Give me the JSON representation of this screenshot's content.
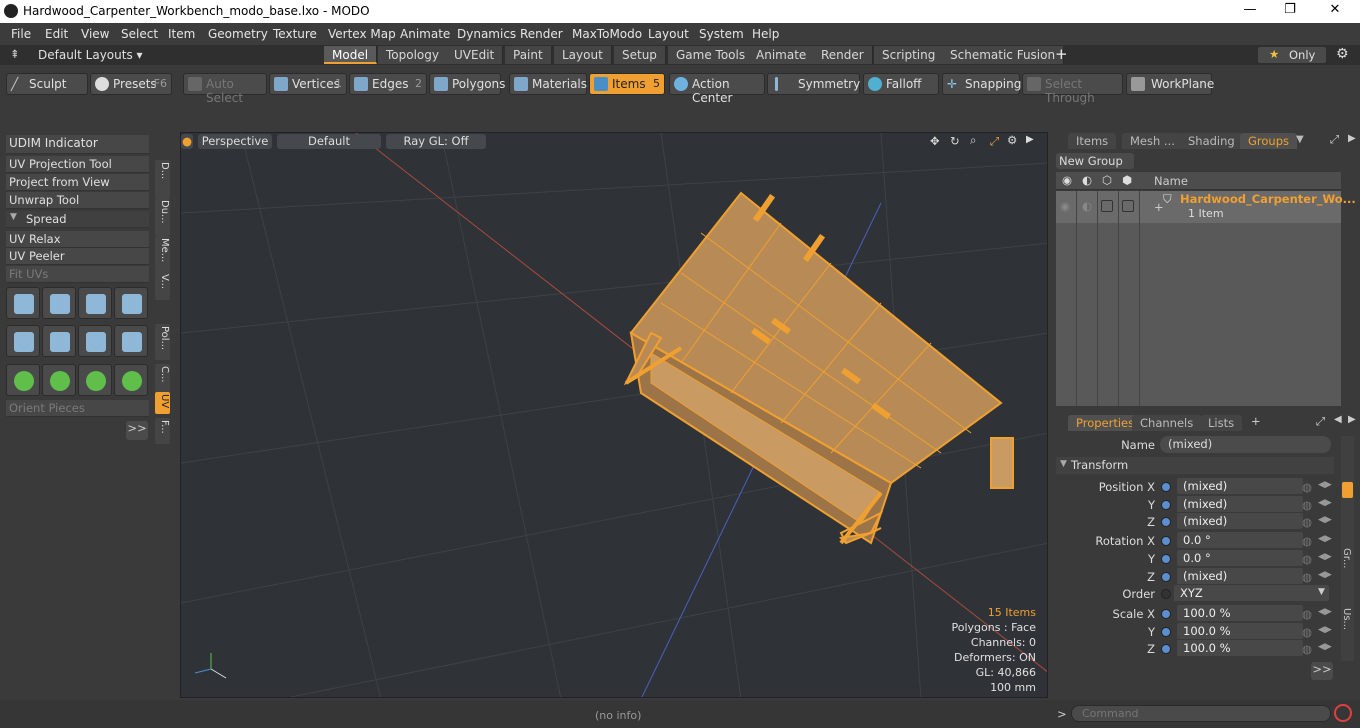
{
  "window": {
    "title": "Hardwood_Carpenter_Workbench_modo_base.lxo - MODO",
    "controls": [
      "—",
      "❐",
      "✕"
    ]
  },
  "menu": [
    "File",
    "Edit",
    "View",
    "Select",
    "Item",
    "Geometry",
    "Texture",
    "Vertex Map",
    "Animate",
    "Dynamics",
    "Render",
    "MaxToModo",
    "Layout",
    "System",
    "Help"
  ],
  "layout_bar": {
    "selector": "Default Layouts ▾",
    "tabs": [
      "Model",
      "Topology",
      "UVEdit",
      "Paint",
      "Layout",
      "Setup",
      "Game Tools",
      "Animate",
      "Render",
      "Scripting",
      "Schematic Fusion"
    ],
    "active_tab": "Model",
    "plus": "+",
    "only": "Only"
  },
  "toolbar": {
    "sculpt": "Sculpt",
    "presets": "Presets",
    "presets_key": "F6",
    "auto_select": "Auto Select",
    "vertices": "Vertices",
    "vertices_n": "1",
    "edges": "Edges",
    "edges_n": "2",
    "polygons": "Polygons",
    "materials": "Materials",
    "items": "Items",
    "items_n": "5",
    "action_center": "Action Center",
    "symmetry": "Symmetry",
    "falloff": "Falloff",
    "snapping": "Snapping",
    "select_through": "Select Through",
    "workplane": "WorkPlane"
  },
  "left": {
    "udim": "UDIM Indicator",
    "uv_projection": "UV Projection Tool",
    "project_from_view": "Project from View",
    "unwrap": "Unwrap Tool",
    "spread": "Spread",
    "uv_relax": "UV Relax",
    "uv_peeler": "UV Peeler",
    "fit_uvs": "Fit UVs",
    "orient_pieces": "Orient Pieces",
    "more": ">>",
    "vtabs": [
      "D...",
      "Du...",
      "Me...",
      "V...",
      "Pol...",
      "C...",
      "UV",
      "F..."
    ]
  },
  "viewport": {
    "view": "Perspective",
    "shading": "Default",
    "raygl": "Ray GL: Off",
    "stats": {
      "items": "15 Items",
      "polygons": "Polygons : Face",
      "channels": "Channels: 0",
      "deformers": "Deformers: ON",
      "gl": "GL: 40,866",
      "unit": "100 mm"
    }
  },
  "status": {
    "info": "(no info)",
    "command_placeholder": "Command"
  },
  "groups": {
    "tabs": [
      "Items",
      "Mesh ...",
      "Shading",
      "Groups"
    ],
    "active": "Groups",
    "new_group": "New Group",
    "col_name": "Name",
    "item_name": "Hardwood_Carpenter_Wo...",
    "item_count": "1 Item"
  },
  "properties": {
    "tabs": [
      "Properties",
      "Channels",
      "Lists"
    ],
    "active": "Properties",
    "plus": "+",
    "name_label": "Name",
    "name_value": "(mixed)",
    "section": "Transform",
    "rows": [
      {
        "label": "Position X",
        "value": "(mixed)"
      },
      {
        "label": "Y",
        "value": "(mixed)"
      },
      {
        "label": "Z",
        "value": "(mixed)"
      },
      {
        "label": "Rotation X",
        "value": "0.0 °"
      },
      {
        "label": "Y",
        "value": "0.0 °"
      },
      {
        "label": "Z",
        "value": "(mixed)"
      },
      {
        "label": "Order",
        "value": "XYZ"
      },
      {
        "label": "Scale X",
        "value": "100.0 %"
      },
      {
        "label": "Y",
        "value": "100.0 %"
      },
      {
        "label": "Z",
        "value": "100.0 %"
      }
    ],
    "side_tabs": [
      "Gr...",
      "Us..."
    ],
    "more": ">>"
  }
}
